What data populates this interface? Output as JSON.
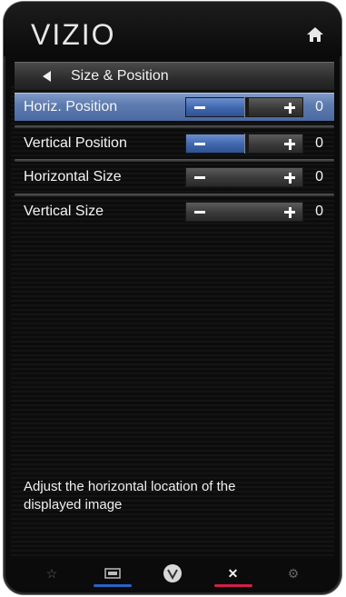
{
  "header": {
    "brand": "VIZIO",
    "home_icon": "home-icon"
  },
  "title_bar": {
    "title": "Size & Position",
    "back_icon": "back-arrow-icon"
  },
  "rows": [
    {
      "label": "Horiz. Position",
      "value": "0",
      "selected": true,
      "level": 0.5
    },
    {
      "label": "Vertical Position",
      "value": "0",
      "selected": false,
      "level": 0.5
    },
    {
      "label": "Horizontal Size",
      "value": "0",
      "selected": false,
      "level": 0.0
    },
    {
      "label": "Vertical Size",
      "value": "0",
      "selected": false,
      "level": 0.0
    }
  ],
  "help_text": "Adjust the horizontal location of the displayed image",
  "bottom_nav": [
    {
      "icon": "star-icon",
      "glyph": "☆",
      "accent": ""
    },
    {
      "icon": "input-icon",
      "glyph": "",
      "accent": "#2a62c8"
    },
    {
      "icon": "vizio-v-icon",
      "glyph": "V",
      "accent": ""
    },
    {
      "icon": "close-icon",
      "glyph": "✕",
      "accent": "#d0204a"
    },
    {
      "icon": "gear-icon",
      "glyph": "⚙",
      "accent": ""
    }
  ],
  "colors": {
    "highlight": "#5f7cb0",
    "slider_fill": "#3f66ad"
  }
}
